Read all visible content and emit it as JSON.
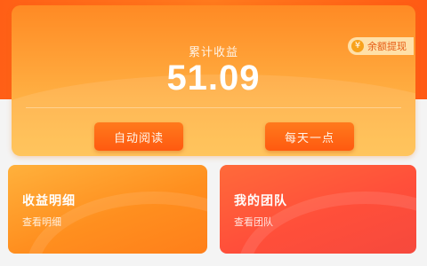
{
  "earnings": {
    "label": "累计收益",
    "value": "51.09",
    "tag": "余额提现"
  },
  "actions": {
    "left_label": "自动阅读",
    "right_label": "每天一点"
  },
  "cards": {
    "income": {
      "title": "收益明细",
      "desc": "查看明细"
    },
    "team": {
      "title": "我的团队",
      "desc": "查看团队"
    }
  },
  "colors": {
    "accent": "#ff6a1a",
    "card_orange": "#ffb043",
    "card_red": "#ff5a3a"
  }
}
